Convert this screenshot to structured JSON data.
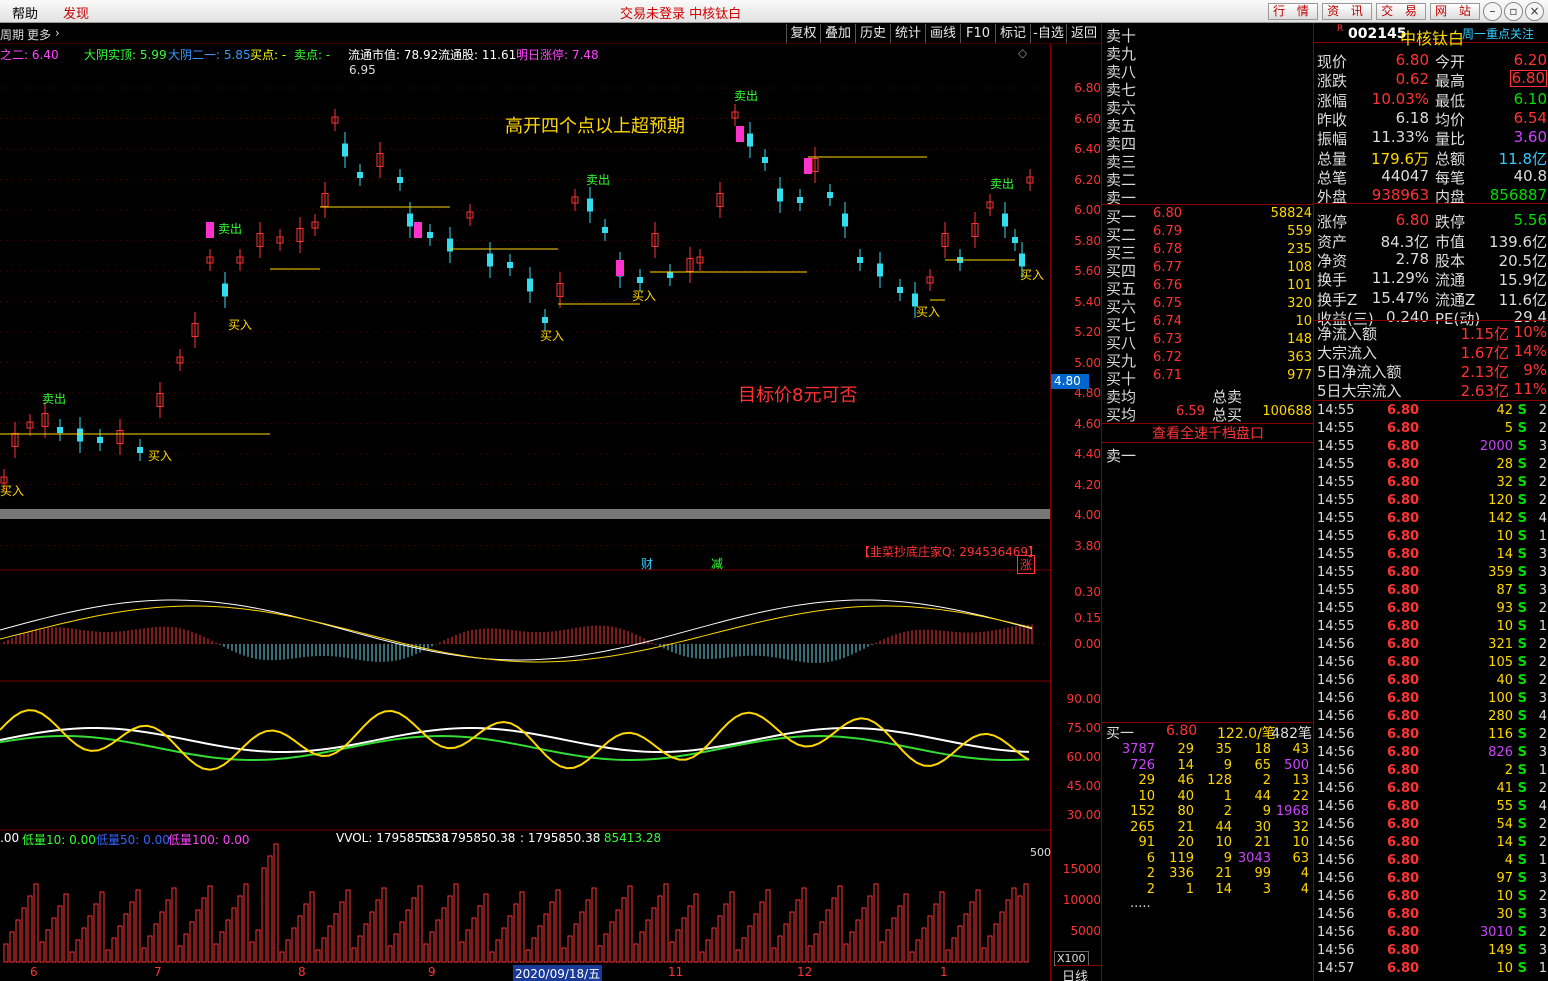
{
  "menubar": {
    "help": "帮助",
    "discover": "发现",
    "notice": "交易未登录  中核钛白",
    "buttons": [
      "行 情",
      "资 讯",
      "交 易",
      "网 站"
    ]
  },
  "toolbar": {
    "period": "周期",
    "more": "更多",
    "buttons": [
      "复权",
      "叠加",
      "历史",
      "统计",
      "画线",
      "F10",
      "标记",
      "-自选",
      "返回"
    ]
  },
  "indicators": [
    {
      "text": "之二: 6.40",
      "color": "#ff44ff"
    },
    {
      "text": "大阴实顶: 5.99",
      "color": "#33ff33"
    },
    {
      "text": "大阴二一: 5.85",
      "color": "#3399ff"
    },
    {
      "text": "买点: -",
      "color": "#ffff00"
    },
    {
      "text": "卖点: -",
      "color": "#33ff33"
    },
    {
      "text": "流通市值: 78.92",
      "color": "#ffffff"
    },
    {
      "text": "流通股: 11.61",
      "color": "#ffffff"
    },
    {
      "text": "明日涨停: 7.48",
      "color": "#ff44ff"
    }
  ],
  "annotations": {
    "title1": "高开四个点以上超预期",
    "title2": "目标价8元可否",
    "qq": "【韭菜抄底庄家Q: 294536469】",
    "cai": "财",
    "jian": "减",
    "zhang": "涨",
    "peak": "6.95",
    "current_price_tag": "4.80",
    "buy": "买入",
    "sell": "卖出"
  },
  "price_axis": [
    "6.80",
    "6.60",
    "6.40",
    "6.20",
    "6.00",
    "5.80",
    "5.60",
    "5.40",
    "5.20",
    "5.00",
    "4.80",
    "4.60",
    "4.40",
    "4.20",
    "4.00",
    "3.80"
  ],
  "macd_axis": [
    "0.30",
    "0.15",
    "0.00"
  ],
  "kdj_axis": [
    "90.00",
    "75.00",
    "60.00",
    "45.00",
    "30.00"
  ],
  "vol_axis": [
    "15000",
    "10000",
    "5000"
  ],
  "vol_unit": "X100",
  "vol_mark": "500",
  "vol_line": [
    {
      "text": ".00",
      "color": "#ffffff"
    },
    {
      "text": "低量10: 0.00",
      "color": "#33ff33"
    },
    {
      "text": "低量50: 0.00",
      "color": "#3366ff"
    },
    {
      "text": "低量100: 0.00",
      "color": "#ff44ff"
    },
    {
      "text": "VVOL: 1795850.38",
      "color": "#ffffff"
    },
    {
      "text": "TS: 1795850.38",
      "color": "#ffffff"
    },
    {
      "text": ": 1795850.38",
      "color": "#ffffff"
    },
    {
      "text": ": 85413.28",
      "color": "#33ff33"
    }
  ],
  "xaxis": [
    "6",
    "7",
    "8",
    "9",
    "2020/09/18/五",
    "11",
    "12",
    "1"
  ],
  "period_label": "日线",
  "quote": {
    "sell_labels": [
      "卖十",
      "卖九",
      "卖八",
      "卖七",
      "卖六",
      "卖五",
      "卖四",
      "卖三",
      "卖二",
      "卖一"
    ],
    "buys": [
      {
        "l": "买一",
        "p": "6.80",
        "v": "58824"
      },
      {
        "l": "买二",
        "p": "6.79",
        "v": "559"
      },
      {
        "l": "买三",
        "p": "6.78",
        "v": "235"
      },
      {
        "l": "买四",
        "p": "6.77",
        "v": "108"
      },
      {
        "l": "买五",
        "p": "6.76",
        "v": "101"
      },
      {
        "l": "买六",
        "p": "6.75",
        "v": "320"
      },
      {
        "l": "买七",
        "p": "6.74",
        "v": "10"
      },
      {
        "l": "买八",
        "p": "6.73",
        "v": "148"
      },
      {
        "l": "买九",
        "p": "6.72",
        "v": "363"
      },
      {
        "l": "买十",
        "p": "6.71",
        "v": "977"
      }
    ],
    "sell_avg": "卖均",
    "total_sell": "总卖",
    "buy_avg": "买均",
    "buy_avg_price": "6.59",
    "total_buy": "总买",
    "total_buy_val": "100688",
    "link": "查看全速千档盘口",
    "sell1": "卖一",
    "buy1_line": {
      "label": "买一",
      "price": "6.80",
      "per": "122.0/笔",
      "count": "482笔"
    },
    "queue": [
      [
        "3787",
        "29",
        "35",
        "18",
        "43"
      ],
      [
        "726",
        "14",
        "9",
        "65",
        "500"
      ],
      [
        "29",
        "46",
        "128",
        "2",
        "13"
      ],
      [
        "10",
        "40",
        "1",
        "44",
        "22"
      ],
      [
        "152",
        "80",
        "2",
        "9",
        "1968"
      ],
      [
        "265",
        "21",
        "44",
        "30",
        "32"
      ],
      [
        "91",
        "20",
        "10",
        "21",
        "10"
      ],
      [
        "6",
        "119",
        "9",
        "3043",
        "63"
      ],
      [
        "2",
        "336",
        "21",
        "99",
        "4"
      ],
      [
        "2",
        "1",
        "14",
        "3",
        "4"
      ]
    ],
    "more": "....."
  },
  "info": {
    "code": "002145",
    "name": "中核钛白",
    "follow": "周一重点关注",
    "r": "R",
    "rows": [
      {
        "l1": "现价",
        "v1": "6.80",
        "c1": "red",
        "l2": "今开",
        "v2": "6.20",
        "c2": "red"
      },
      {
        "l1": "涨跌",
        "v1": "0.62",
        "c1": "red",
        "l2": "最高",
        "v2": "6.80",
        "c2": "red",
        "box": true
      },
      {
        "l1": "涨幅",
        "v1": "10.03%",
        "c1": "red",
        "l2": "最低",
        "v2": "6.10",
        "c2": "grn"
      },
      {
        "l1": "昨收",
        "v1": "6.18",
        "c1": "wht",
        "l2": "均价",
        "v2": "6.54",
        "c2": "red"
      },
      {
        "l1": "振幅",
        "v1": "11.33%",
        "c1": "wht",
        "l2": "量比",
        "v2": "3.60",
        "c2": "mag"
      },
      {
        "l1": "总量",
        "v1": "179.6万",
        "c1": "yel",
        "l2": "总额",
        "v2": "11.8亿",
        "c2": "cy"
      },
      {
        "l1": "总笔",
        "v1": "44047",
        "c1": "wht",
        "l2": "每笔",
        "v2": "40.8",
        "c2": "wht"
      },
      {
        "l1": "外盘",
        "v1": "938963",
        "c1": "red",
        "l2": "内盘",
        "v2": "856887",
        "c2": "grn"
      },
      {
        "l1": "涨停",
        "v1": "6.80",
        "c1": "red",
        "l2": "跌停",
        "v2": "5.56",
        "c2": "grn"
      },
      {
        "l1": "资产",
        "v1": "84.3亿",
        "c1": "wht",
        "l2": "市值",
        "v2": "139.6亿",
        "c2": "wht"
      },
      {
        "l1": "净资",
        "v1": "2.78",
        "c1": "wht",
        "l2": "股本",
        "v2": "20.5亿",
        "c2": "wht"
      },
      {
        "l1": "换手",
        "v1": "11.29%",
        "c1": "wht",
        "l2": "流通",
        "v2": "15.9亿",
        "c2": "wht"
      },
      {
        "l1": "换手Z",
        "v1": "15.47%",
        "c1": "wht",
        "l2": "流通Z",
        "v2": "11.6亿",
        "c2": "wht"
      },
      {
        "l1": "收益(三)",
        "v1": "0.240",
        "c1": "wht",
        "l2": "PE(动)",
        "v2": "29.4",
        "c2": "wht"
      }
    ],
    "flows": [
      {
        "l": "净流入额",
        "v": "1.15亿",
        "p": "10%"
      },
      {
        "l": "大宗流入",
        "v": "1.67亿",
        "p": "14%"
      },
      {
        "l": "5日净流入额",
        "v": "2.13亿",
        "p": "9%"
      },
      {
        "l": "5日大宗流入",
        "v": "2.63亿",
        "p": "11%"
      }
    ],
    "ticks": [
      [
        "14:55",
        "6.80",
        "42",
        "S",
        "2"
      ],
      [
        "14:55",
        "6.80",
        "5",
        "S",
        "2"
      ],
      [
        "14:55",
        "6.80",
        "2000",
        "S",
        "3"
      ],
      [
        "14:55",
        "6.80",
        "28",
        "S",
        "2"
      ],
      [
        "14:55",
        "6.80",
        "32",
        "S",
        "2"
      ],
      [
        "14:55",
        "6.80",
        "120",
        "S",
        "2"
      ],
      [
        "14:55",
        "6.80",
        "142",
        "S",
        "4"
      ],
      [
        "14:55",
        "6.80",
        "10",
        "S",
        "1"
      ],
      [
        "14:55",
        "6.80",
        "14",
        "S",
        "3"
      ],
      [
        "14:55",
        "6.80",
        "359",
        "S",
        "3"
      ],
      [
        "14:55",
        "6.80",
        "87",
        "S",
        "3"
      ],
      [
        "14:55",
        "6.80",
        "93",
        "S",
        "2"
      ],
      [
        "14:55",
        "6.80",
        "10",
        "S",
        "1"
      ],
      [
        "14:56",
        "6.80",
        "321",
        "S",
        "2"
      ],
      [
        "14:56",
        "6.80",
        "105",
        "S",
        "2"
      ],
      [
        "14:56",
        "6.80",
        "40",
        "S",
        "2"
      ],
      [
        "14:56",
        "6.80",
        "100",
        "S",
        "3"
      ],
      [
        "14:56",
        "6.80",
        "280",
        "S",
        "4"
      ],
      [
        "14:56",
        "6.80",
        "116",
        "S",
        "2"
      ],
      [
        "14:56",
        "6.80",
        "826",
        "S",
        "3"
      ],
      [
        "14:56",
        "6.80",
        "2",
        "S",
        "1"
      ],
      [
        "14:56",
        "6.80",
        "41",
        "S",
        "2"
      ],
      [
        "14:56",
        "6.80",
        "55",
        "S",
        "4"
      ],
      [
        "14:56",
        "6.80",
        "54",
        "S",
        "2"
      ],
      [
        "14:56",
        "6.80",
        "14",
        "S",
        "2"
      ],
      [
        "14:56",
        "6.80",
        "4",
        "S",
        "1"
      ],
      [
        "14:56",
        "6.80",
        "97",
        "S",
        "3"
      ],
      [
        "14:56",
        "6.80",
        "10",
        "S",
        "2"
      ],
      [
        "14:56",
        "6.80",
        "30",
        "S",
        "3"
      ],
      [
        "14:56",
        "6.80",
        "3010",
        "S",
        "2"
      ],
      [
        "14:56",
        "6.80",
        "149",
        "S",
        "3"
      ],
      [
        "14:57",
        "6.80",
        "10",
        "S",
        "1"
      ]
    ]
  },
  "colors": {
    "up": "#ff3333",
    "down": "#33ddee",
    "bg": "#000000",
    "axis": "#880000",
    "yellow": "#ffd800"
  }
}
